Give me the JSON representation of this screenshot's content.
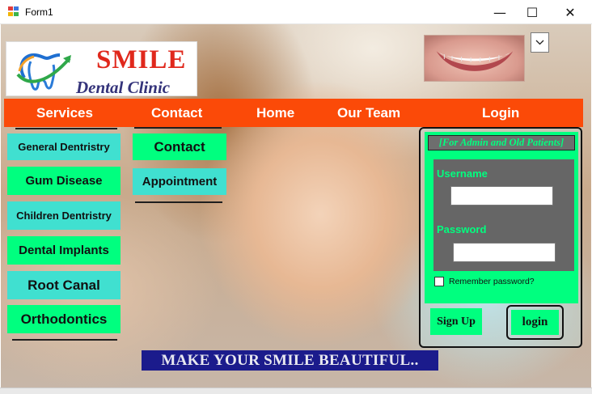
{
  "window": {
    "title": "Form1",
    "minimize_glyph": "—",
    "maximize_glyph": "☐",
    "close_glyph": "✕",
    "icon": "form-app-icon"
  },
  "logo": {
    "brand": "SMILE",
    "subtitle": "Dental Clinic",
    "icon": "tooth-logo-icon",
    "brand_color": "#e0281c",
    "subtitle_color": "#34337a"
  },
  "header_image": {
    "icon": "smile-teeth-image"
  },
  "combo": {
    "icon": "chevron-down-icon"
  },
  "navbar": {
    "color": "#fb4a08",
    "items": [
      "Services",
      "Contact",
      "Home",
      "Our Team",
      "Login"
    ]
  },
  "services": {
    "items": [
      "General Dentristry",
      "Gum Disease",
      "Children Dentristry",
      "Dental Implants",
      "Root Canal",
      "Orthodontics"
    ]
  },
  "contact": {
    "items": [
      "Contact",
      "Appointment"
    ]
  },
  "tagline": "MAKE YOUR SMILE BEAUTIFUL..",
  "login_panel": {
    "title": "[For Admin and Old Patients]",
    "username_label": "Username",
    "username_value": "",
    "password_label": "Password",
    "password_value": "",
    "remember_label": "Remember password?",
    "remember_checked": false,
    "signup_label": "Sign Up",
    "login_label": "login",
    "accent": "#00ff7f"
  },
  "colors": {
    "cyan_button": "#40e0d0",
    "green_button": "#00ff7f",
    "tagline_bg": "#1b1b8c"
  }
}
